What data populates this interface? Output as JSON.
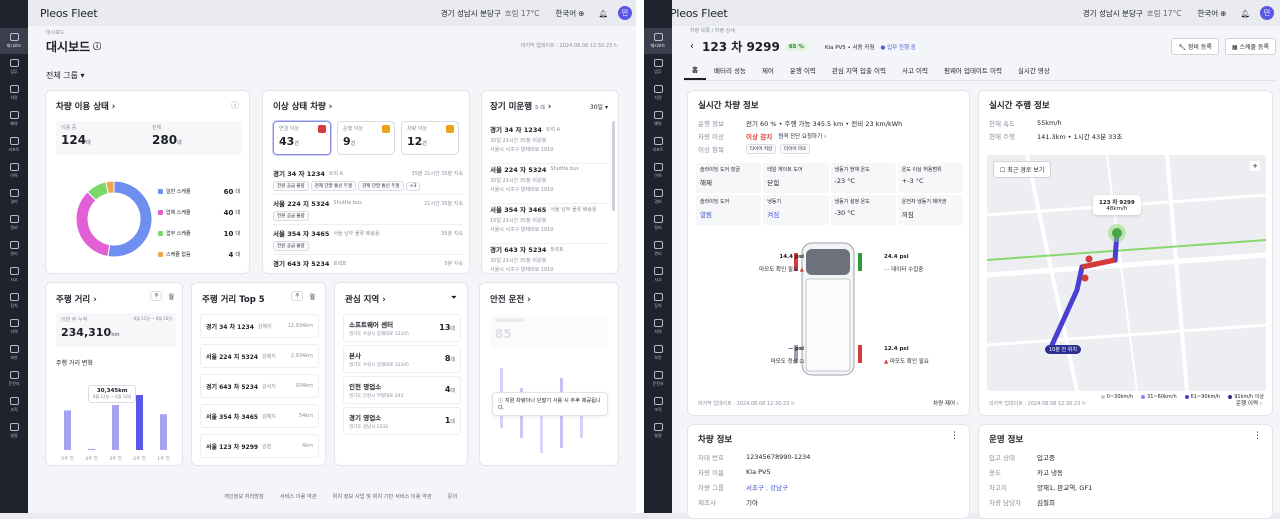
{
  "app": {
    "logo": "Pleos Fleet",
    "location": "경기 성남시 분당구",
    "weather": "흐림 17°C",
    "language": "한국어",
    "avatar": "민"
  },
  "sidebar": {
    "active_label": "대시보드",
    "items": [
      "업무",
      "차량",
      "예약",
      "리포트",
      "이력",
      "경비",
      "정비",
      "관리",
      "사고",
      "장치",
      "지역",
      "보안",
      "운전자",
      "조직",
      "설정"
    ]
  },
  "dashboard": {
    "breadcrumb": "대시보드",
    "title": "대시보드",
    "updated": "마지막 업데이트 : 2024.08.08 12:30:23",
    "group": "전체 그룹",
    "usage": {
      "title": "차량 이용 상태",
      "in_use_label": "이용 중",
      "in_use": "124",
      "total_label": "전체",
      "total": "280",
      "unit": "대",
      "legend": [
        {
          "label": "일반 스케쥴",
          "value": "60"
        },
        {
          "label": "업체 스케쥴",
          "value": "40"
        },
        {
          "label": "업무 스케쥴",
          "value": "10"
        },
        {
          "label": "스케쥴 없음",
          "value": "4"
        }
      ],
      "colors": [
        "#6f8ff0",
        "#e25fd6",
        "#7bd86b",
        "#f0a64a"
      ]
    },
    "abnormal": {
      "title": "이상 상태 차량",
      "boxes": [
        {
          "label": "연결 이상",
          "value": "43",
          "unit": "건"
        },
        {
          "label": "운행 이상",
          "value": "9",
          "unit": "건"
        },
        {
          "label": "차량 이상",
          "value": "12",
          "unit": "건"
        }
      ],
      "rows": [
        {
          "plate": "경기 34 자 1234",
          "type": "트럭 A",
          "time": "35분 21시간 35분 지속",
          "chips": [
            "전원 공급 불량",
            "관제 단말 통신 두절",
            "관제 단말 통신 두절",
            "+3"
          ]
        },
        {
          "plate": "서울 224 지 5324",
          "type": "Shuttle bus",
          "time": "21시간 35분 지속",
          "chips": [
            "전원 공급 불량"
          ]
        },
        {
          "plate": "서울 354 자 3465",
          "type": "서울 남부 물류 배송용",
          "time": "35분 지속",
          "chips": [
            "전원 공급 불량"
          ]
        },
        {
          "plate": "경기 643 자 5234",
          "type": "트럭B",
          "time": "5분 지속",
          "chips": []
        }
      ]
    },
    "longidle": {
      "title": "장기 미운행",
      "count": "5 대",
      "period": "30일",
      "rows": [
        {
          "plate": "경기 34 자 1234",
          "type": "트럭 A",
          "days": "35일 21시간 35분 미운행",
          "addr": "서울시 서초구 양재대로 1010"
        },
        {
          "plate": "서울 224 자 5324",
          "type": "Shuttle bus",
          "days": "35일 21시간 35분 미운행",
          "addr": "서울시 서초구 양재대로 1010"
        },
        {
          "plate": "서울 354 자 3465",
          "type": "서울 남부 물류 배송용",
          "days": "15일 21시간 35분 미운행",
          "addr": "서울시 서초구 양재대로 1010"
        },
        {
          "plate": "경기 643 자 5234",
          "type": "트럭B",
          "days": "35일 21시간 35분 미운행",
          "addr": "서울시 서초구 양재대로 1010"
        }
      ]
    },
    "distance": {
      "title": "주행 거리",
      "tabs": [
        "주",
        "월"
      ],
      "week_label": "이번 주 누적",
      "value": "234,310",
      "unit": "km",
      "dates": "8월 12일 ~ 8월 18일",
      "change_label": "주행 거리 변화",
      "tooltip": "30,345km",
      "tooltip_dates": "8월 12일 ~ 8월 18일",
      "days": [
        "5주 전",
        "4주 전",
        "3주 전",
        "2주 전",
        "1주 전"
      ],
      "values": [
        0.72,
        0.02,
        0.82,
        1.0,
        0.65
      ]
    },
    "top5": {
      "title": "주행 거리 Top 5",
      "tabs": [
        "주",
        "월"
      ],
      "rows": [
        {
          "plate": "경기 34 차 1234",
          "driver": "김혜지",
          "km": "12,934km"
        },
        {
          "plate": "서울 224 지 5324",
          "driver": "김혜지",
          "km": "2,934km"
        },
        {
          "plate": "경기 643 차 5234",
          "driver": "김서지",
          "km": "934km"
        },
        {
          "plate": "서울 354 차 3465",
          "driver": "김혜지",
          "km": "54km"
        },
        {
          "plate": "서울 123 차 9299",
          "driver": "김철",
          "km": "4km"
        }
      ]
    },
    "regions": {
      "title": "관심 지역",
      "rows": [
        {
          "name": "소프트웨어 센터",
          "addr": "경기도 수원시 양재대로 12345",
          "count": "13"
        },
        {
          "name": "본사",
          "addr": "경기도 수원시 양재대로 12345",
          "count": "8"
        },
        {
          "name": "인천 영업소",
          "addr": "경기도 인천시 부평대로 243",
          "count": "4"
        },
        {
          "name": "경기 영업소",
          "addr": "경기도 성남시 2232",
          "count": "1"
        }
      ],
      "unit": "대"
    },
    "safety": {
      "title": "안전 운전",
      "score": "85",
      "notice": "지원 차량이나 단말기 사용 시 추후 제공됩니다."
    },
    "footer": [
      "개인정보 처리방침",
      "서비스 이용 약관",
      "위치 정보 사업 및 위치 기반 서비스 이용 약관",
      "문의"
    ]
  },
  "detail": {
    "breadcrumb": "차량 목록 / 차량 상세",
    "plate": "123 차 9299",
    "battery": "65 %",
    "model": "Kia PV5 • 서동 커짐",
    "status": "업무 진행 중",
    "btn_maint": "정비 등록",
    "btn_sched": "스케줄 등록",
    "tabs": [
      "홈",
      "배터리 성능",
      "제어",
      "운행 이력",
      "관심 지역 입출 이력",
      "사고 이력",
      "펌웨어 업데이트 이력",
      "실시간 영상"
    ],
    "realtime": {
      "title": "실시간 차량 정보",
      "run_label": "운행 정보",
      "run_value": "전기 60 % • 주행 가능 345.5 km • 전비 23 km/kWh",
      "abn_label": "차량 이상",
      "abn_value": "이상 감지",
      "abn_link": "원격 진단 요청하기",
      "warn_label": "이상 항목",
      "warn_chips": [
        "타이어 저압",
        "타이어 마모"
      ],
      "grid": [
        {
          "k": "슬라이딩 도어 잠금",
          "v": "해제"
        },
        {
          "k": "테일 게이트 도어",
          "v": "닫힘"
        },
        {
          "k": "냉동기 현재 온도",
          "v": "-23 °C"
        },
        {
          "k": "온도 이상 허용범위",
          "v": "+-3 °C"
        },
        {
          "k": "슬라이딩 도어",
          "v": "열림"
        },
        {
          "k": "냉동기",
          "v": "켜짐"
        },
        {
          "k": "냉동기 설정 온도",
          "v": "-30 °C"
        },
        {
          "k": "운전자 냉동기 제어권",
          "v": "꺼짐"
        }
      ],
      "tires": [
        {
          "psi": "14.4 psi",
          "note": "마모도 확인 필요"
        },
        {
          "psi": "24.4 psi",
          "note": "데이터 수집중"
        },
        {
          "psi": "-- psi",
          "note": "마모도 정상"
        },
        {
          "psi": "12.4 psi",
          "note": "마모도 확인 필요"
        }
      ],
      "updated": "마지막 업데이트 : 2024.08.08 12:30:23",
      "control": "차량 제어"
    },
    "drive": {
      "title": "실시간 주행 정보",
      "speed_label": "현재 속도",
      "speed": "55km/h",
      "time_label": "현재 주행",
      "time": "141.3km • 1시간 43분 33초",
      "route_btn": "최근 경로 보기",
      "badge": "123 차 9299",
      "badge_speed": "48km/h",
      "pin": "10분 전 위치",
      "legend": [
        "0~30km/h",
        "31~60km/h",
        "61~90km/h",
        "91km/h 이상"
      ],
      "updated": "마지막 업데이트 : 2024.08.08 12:30:23",
      "history": "운행 이력"
    },
    "vehicle": {
      "title": "차량 정보",
      "rows": [
        {
          "k": "차대 번호",
          "v": "12345678990-1234"
        },
        {
          "k": "차량 이름",
          "v": "Kia PV5"
        },
        {
          "k": "차량 그룹",
          "v": "서초구 , 강남구"
        },
        {
          "k": "제조사",
          "v": "기아"
        }
      ]
    },
    "ops": {
      "title": "운영 정보",
      "rows": [
        {
          "k": "입고 상태",
          "v": "입고중"
        },
        {
          "k": "용도",
          "v": "카고 냉동"
        },
        {
          "k": "차고지",
          "v": "양재1, 판교역, GF1"
        },
        {
          "k": "차량 담당자",
          "v": "김철희"
        }
      ]
    }
  }
}
